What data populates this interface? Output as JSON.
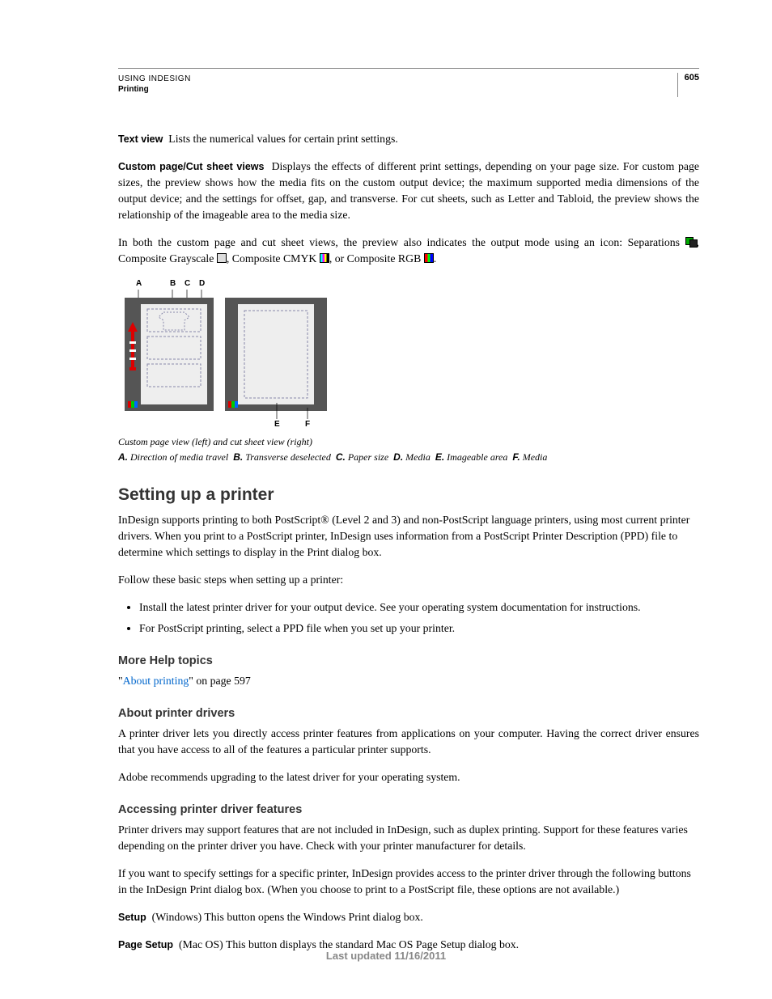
{
  "header": {
    "running_title": "USING INDESIGN",
    "running_section": "Printing",
    "page_number": "605"
  },
  "defs": {
    "text_view": {
      "label": "Text view",
      "body": "Lists the numerical values for certain print settings."
    },
    "custom_view": {
      "label": "Custom page/Cut sheet views",
      "body": "Displays the effects of different print settings, depending on your page size. For custom page sizes, the preview shows how the media fits on the custom output device; the maximum supported media dimensions of the output device; and the settings for offset, gap, and transverse. For cut sheets, such as Letter and Tabloid, the preview shows the relationship of the imageable area to the media size."
    }
  },
  "icons_para": {
    "lead": "In both the custom page and cut sheet views, the preview also indicates the output mode using an icon: Separations ",
    "gray": ", Composite Grayscale ",
    "cmyk": ", Composite CMYK ",
    "rgb": ", or Composite RGB ",
    "end": "."
  },
  "figure": {
    "top_labels": {
      "A": "A",
      "B": "B",
      "C": "C",
      "D": "D"
    },
    "bottom_labels": {
      "E": "E",
      "F": "F"
    },
    "caption": "Custom page view (left) and cut sheet view (right)",
    "keys": [
      {
        "k": "A.",
        "t": "Direction of media travel"
      },
      {
        "k": "B.",
        "t": "Transverse deselected"
      },
      {
        "k": "C.",
        "t": "Paper size"
      },
      {
        "k": "D.",
        "t": "Media"
      },
      {
        "k": "E.",
        "t": "Imageable area"
      },
      {
        "k": "F.",
        "t": "Media"
      }
    ]
  },
  "section": {
    "heading": "Setting up a printer",
    "intro": "InDesign supports printing to both PostScript® (Level 2 and 3) and non-PostScript language printers, using most current printer drivers. When you print to a PostScript printer, InDesign uses information from a PostScript Printer Description (PPD) file to determine which settings to display in the Print dialog box.",
    "steps_lead": "Follow these basic steps when setting up a printer:",
    "bullets": [
      "Install the latest printer driver for your output device. See your operating system documentation for instructions.",
      "For PostScript printing, select a PPD file when you set up your printer."
    ],
    "more_help_heading": "More Help topics",
    "more_help_link": "About printing",
    "more_help_tail": "\" on page 597",
    "quote_open": "\""
  },
  "drivers": {
    "heading": "About printer drivers",
    "p1": "A printer driver lets you directly access printer features from applications on your computer. Having the correct driver ensures that you have access to all of the features a particular printer supports.",
    "p2": "Adobe recommends upgrading to the latest driver for your operating system."
  },
  "features": {
    "heading": "Accessing printer driver features",
    "p1": "Printer drivers may support features that are not included in InDesign, such as duplex printing. Support for these features varies depending on the printer driver you have. Check with your printer manufacturer for details.",
    "p2": "If you want to specify settings for a specific printer, InDesign provides access to the printer driver through the following buttons in the InDesign Print dialog box. (When you choose to print to a PostScript file, these options are not available.)",
    "setup": {
      "label": "Setup",
      "body": "(Windows) This button opens the Windows Print dialog box."
    },
    "page_setup": {
      "label": "Page Setup",
      "body": "(Mac OS) This button displays the standard Mac OS Page Setup dialog box."
    }
  },
  "footer": "Last updated 11/16/2011"
}
